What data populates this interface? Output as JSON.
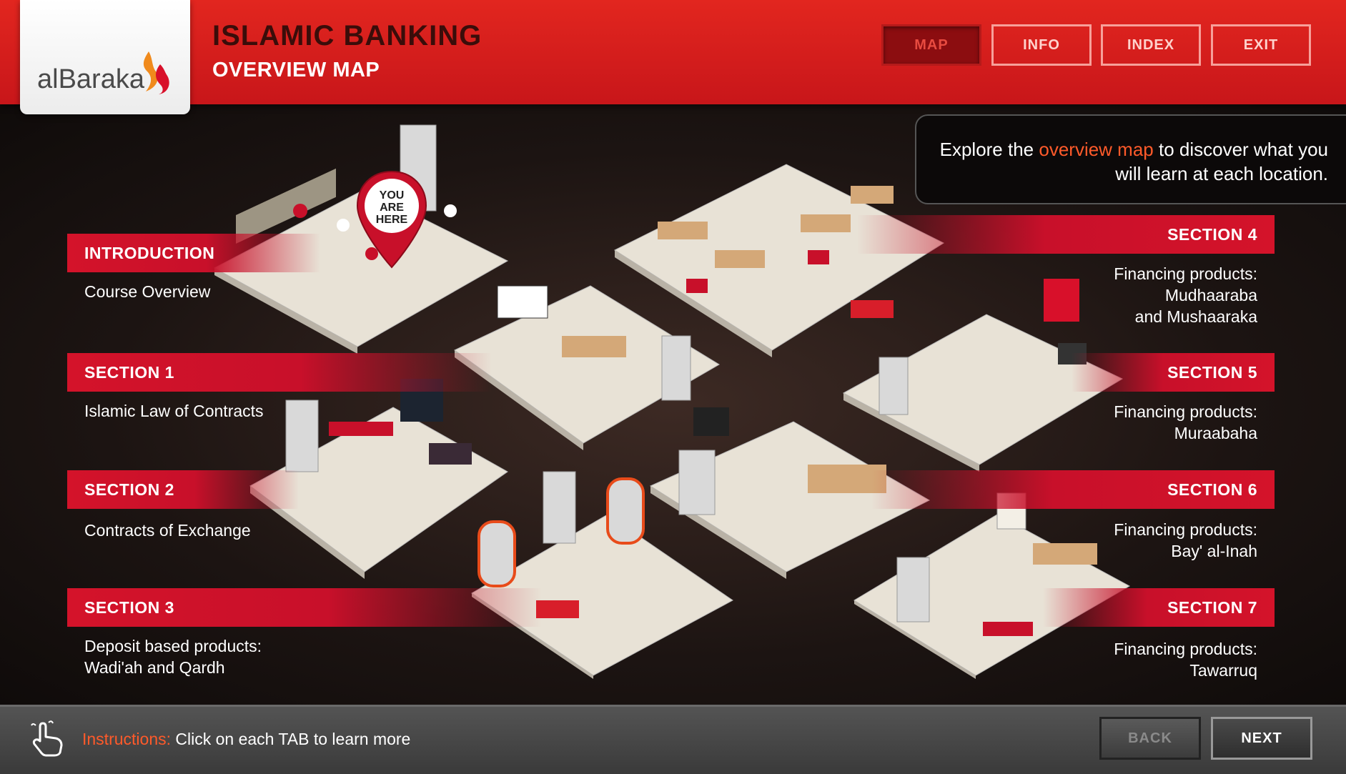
{
  "header": {
    "logo_text": "alBaraka",
    "title": "ISLAMIC BANKING",
    "subtitle": "OVERVIEW MAP",
    "nav": {
      "map": "MAP",
      "info": "INFO",
      "index": "INDEX",
      "exit": "EXIT"
    },
    "active_nav": "MAP"
  },
  "tip": {
    "pre": "Explore the ",
    "highlight": "overview map",
    "post": " to discover what you will learn at each location."
  },
  "marker": {
    "line1": "YOU",
    "line2": "ARE",
    "line3": "HERE"
  },
  "sections": {
    "intro": {
      "tab": "INTRODUCTION",
      "desc": "Course Overview"
    },
    "s1": {
      "tab": "SECTION 1",
      "desc": "Islamic Law of Contracts"
    },
    "s2": {
      "tab": "SECTION 2",
      "desc": "Contracts of Exchange"
    },
    "s3": {
      "tab": "SECTION 3",
      "desc1": "Deposit based products:",
      "desc2": "Wadi'ah and Qardh"
    },
    "s4": {
      "tab": "SECTION 4",
      "desc1": "Financing products:",
      "desc2": "Mudhaaraba",
      "desc3": "and Mushaaraka"
    },
    "s5": {
      "tab": "SECTION 5",
      "desc1": "Financing products:",
      "desc2": "Muraabaha"
    },
    "s6": {
      "tab": "SECTION 6",
      "desc1": "Financing products:",
      "desc2": "Bay' al-Inah"
    },
    "s7": {
      "tab": "SECTION 7",
      "desc1": "Financing products:",
      "desc2": "Tawarruq"
    }
  },
  "footer": {
    "instructions_label": "Instructions:",
    "instructions_text": " Click on each TAB to learn more",
    "back": "BACK",
    "next": "NEXT"
  },
  "colors": {
    "brand_red": "#c8161a",
    "accent_orange": "#ff5a2a",
    "tab_red": "#c8102a"
  }
}
